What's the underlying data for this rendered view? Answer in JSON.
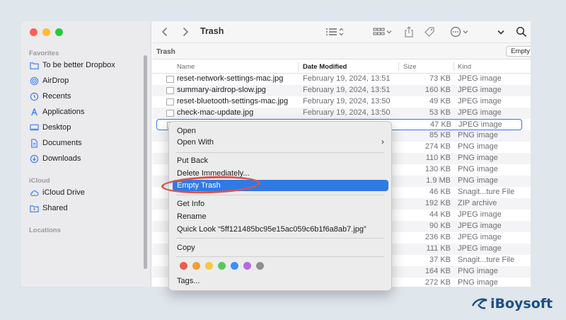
{
  "window": {
    "title": "Trash"
  },
  "sidebar": {
    "favorites_heading": "Favorites",
    "favorites": [
      {
        "label": "To be better Dropbox",
        "icon": "folder-icon"
      },
      {
        "label": "AirDrop",
        "icon": "airdrop-icon"
      },
      {
        "label": "Recents",
        "icon": "clock-icon"
      },
      {
        "label": "Applications",
        "icon": "applications-icon"
      },
      {
        "label": "Desktop",
        "icon": "desktop-icon"
      },
      {
        "label": "Documents",
        "icon": "document-icon"
      },
      {
        "label": "Downloads",
        "icon": "download-icon"
      }
    ],
    "icloud_heading": "iCloud",
    "icloud": [
      {
        "label": "iCloud Drive",
        "icon": "cloud-icon"
      },
      {
        "label": "Shared",
        "icon": "shared-folder-icon"
      }
    ],
    "locations_heading": "Locations"
  },
  "path_bar": {
    "label": "Trash",
    "empty_button": "Empty"
  },
  "columns": {
    "name": "Name",
    "date": "Date Modified",
    "size": "Size",
    "kind": "Kind"
  },
  "files": [
    {
      "name": "reset-network-settings-mac.jpg",
      "date": "February 19, 2024, 13:51",
      "size": "73 KB",
      "kind": "JPEG image"
    },
    {
      "name": "summary-airdrop-slow.jpg",
      "date": "February 19, 2024, 13:51",
      "size": "160 KB",
      "kind": "JPEG image"
    },
    {
      "name": "reset-bluetooth-settings-mac.jpg",
      "date": "February 19, 2024, 13:50",
      "size": "49 KB",
      "kind": "JPEG image"
    },
    {
      "name": "check-mac-update.jpg",
      "date": "February 19, 2024, 13:50",
      "size": "53 KB",
      "kind": "JPEG image"
    },
    {
      "name": "",
      "date": "",
      "size": "47 KB",
      "kind": "JPEG image"
    },
    {
      "name": "",
      "date": "",
      "size": "85 KB",
      "kind": "PNG image"
    },
    {
      "name": "",
      "date": "",
      "size": "274 KB",
      "kind": "PNG image"
    },
    {
      "name": "",
      "date": "",
      "size": "110 KB",
      "kind": "PNG image"
    },
    {
      "name": "",
      "date": "",
      "size": "130 KB",
      "kind": "PNG image"
    },
    {
      "name": "",
      "date": "",
      "size": "1.9 MB",
      "kind": "PNG image"
    },
    {
      "name": "",
      "date": "",
      "size": "46 KB",
      "kind": "Snagit...ture File"
    },
    {
      "name": "",
      "date": "",
      "size": "192 KB",
      "kind": "ZIP archive"
    },
    {
      "name": "",
      "date": "",
      "size": "44 KB",
      "kind": "JPEG image"
    },
    {
      "name": "",
      "date": "",
      "size": "90 KB",
      "kind": "JPEG image"
    },
    {
      "name": "",
      "date": "",
      "size": "236 KB",
      "kind": "JPEG image"
    },
    {
      "name": "",
      "date": "",
      "size": "111 KB",
      "kind": "JPEG image"
    },
    {
      "name": "",
      "date": "",
      "size": "37 KB",
      "kind": "Snagit...ture File"
    },
    {
      "name": "",
      "date": "",
      "size": "164 KB",
      "kind": "PNG image"
    },
    {
      "name": "",
      "date": "",
      "size": "272 KB",
      "kind": "PNG image"
    }
  ],
  "context_menu": {
    "open": "Open",
    "open_with": "Open With",
    "put_back": "Put Back",
    "delete_immediately": "Delete Immediately...",
    "empty_trash": "Empty Trash",
    "get_info": "Get Info",
    "rename": "Rename",
    "quick_look": "Quick Look “5ff121485bc95e15ac059c6b1f6a8ab7.jpg”",
    "copy": "Copy",
    "tags": "Tags...",
    "tag_colors": [
      "#ec5b4f",
      "#f39c38",
      "#f5c843",
      "#5bc65b",
      "#3f8ff2",
      "#b56be0",
      "#8e8e93"
    ],
    "highlight_color": "#2f7ae5"
  },
  "annotation": {
    "color": "#d9534f"
  },
  "brand": {
    "name": "iBoysoft",
    "color": "#1d4f86"
  }
}
